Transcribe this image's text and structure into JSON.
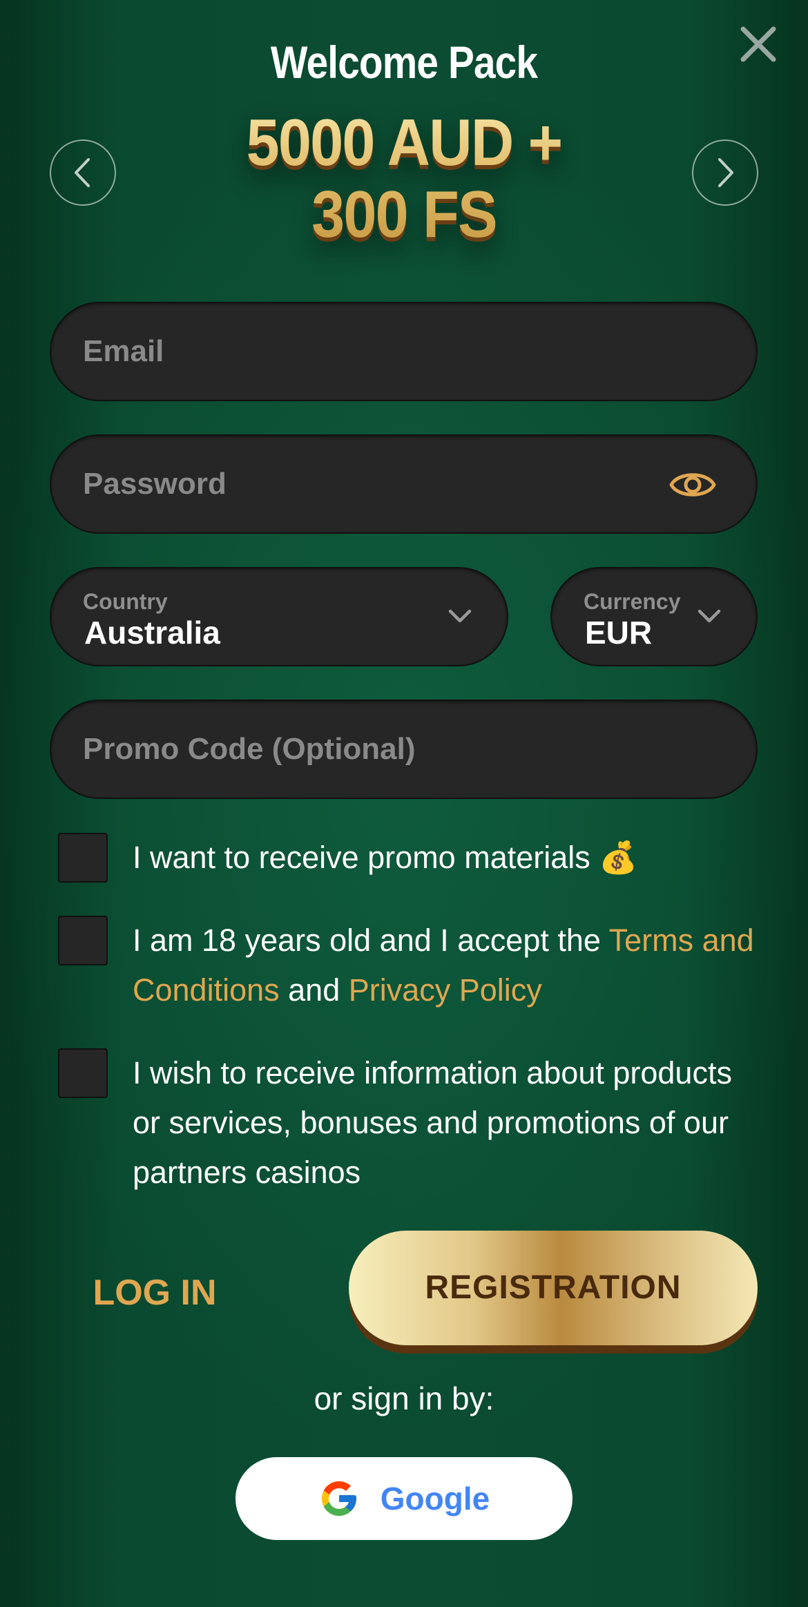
{
  "header": {
    "title": "Welcome Pack",
    "bonus_line1": "5000 AUD +",
    "bonus_line2": "300 FS"
  },
  "form": {
    "email_placeholder": "Email",
    "password_placeholder": "Password",
    "country_label": "Country",
    "country_value": "Australia",
    "currency_label": "Currency",
    "currency_value": "EUR",
    "promo_placeholder": "Promo Code (Optional)"
  },
  "checkboxes": {
    "promo_text": "I want to receive promo materials 💰",
    "age_prefix": "I am 18 years old and I accept the ",
    "terms_link": "Terms and Conditions",
    "age_and": " and ",
    "privacy_link": "Privacy Policy",
    "partners_text": "I wish to receive information about products or services, bonuses and promotions of our partners casinos"
  },
  "actions": {
    "login_label": "LOG IN",
    "register_label": "REGISTRATION",
    "or_sign_in": "or sign in by:",
    "google_label": "Google"
  },
  "icons": {
    "close": "close-icon",
    "prev": "chevron-left-icon",
    "next": "chevron-right-icon",
    "eye": "eye-icon",
    "dropdown": "chevron-down-icon",
    "google": "google-icon"
  },
  "colors": {
    "background": "#0b4c32",
    "field": "#262626",
    "accent_gold": "#e0a752",
    "google_blue": "#4285f4"
  }
}
